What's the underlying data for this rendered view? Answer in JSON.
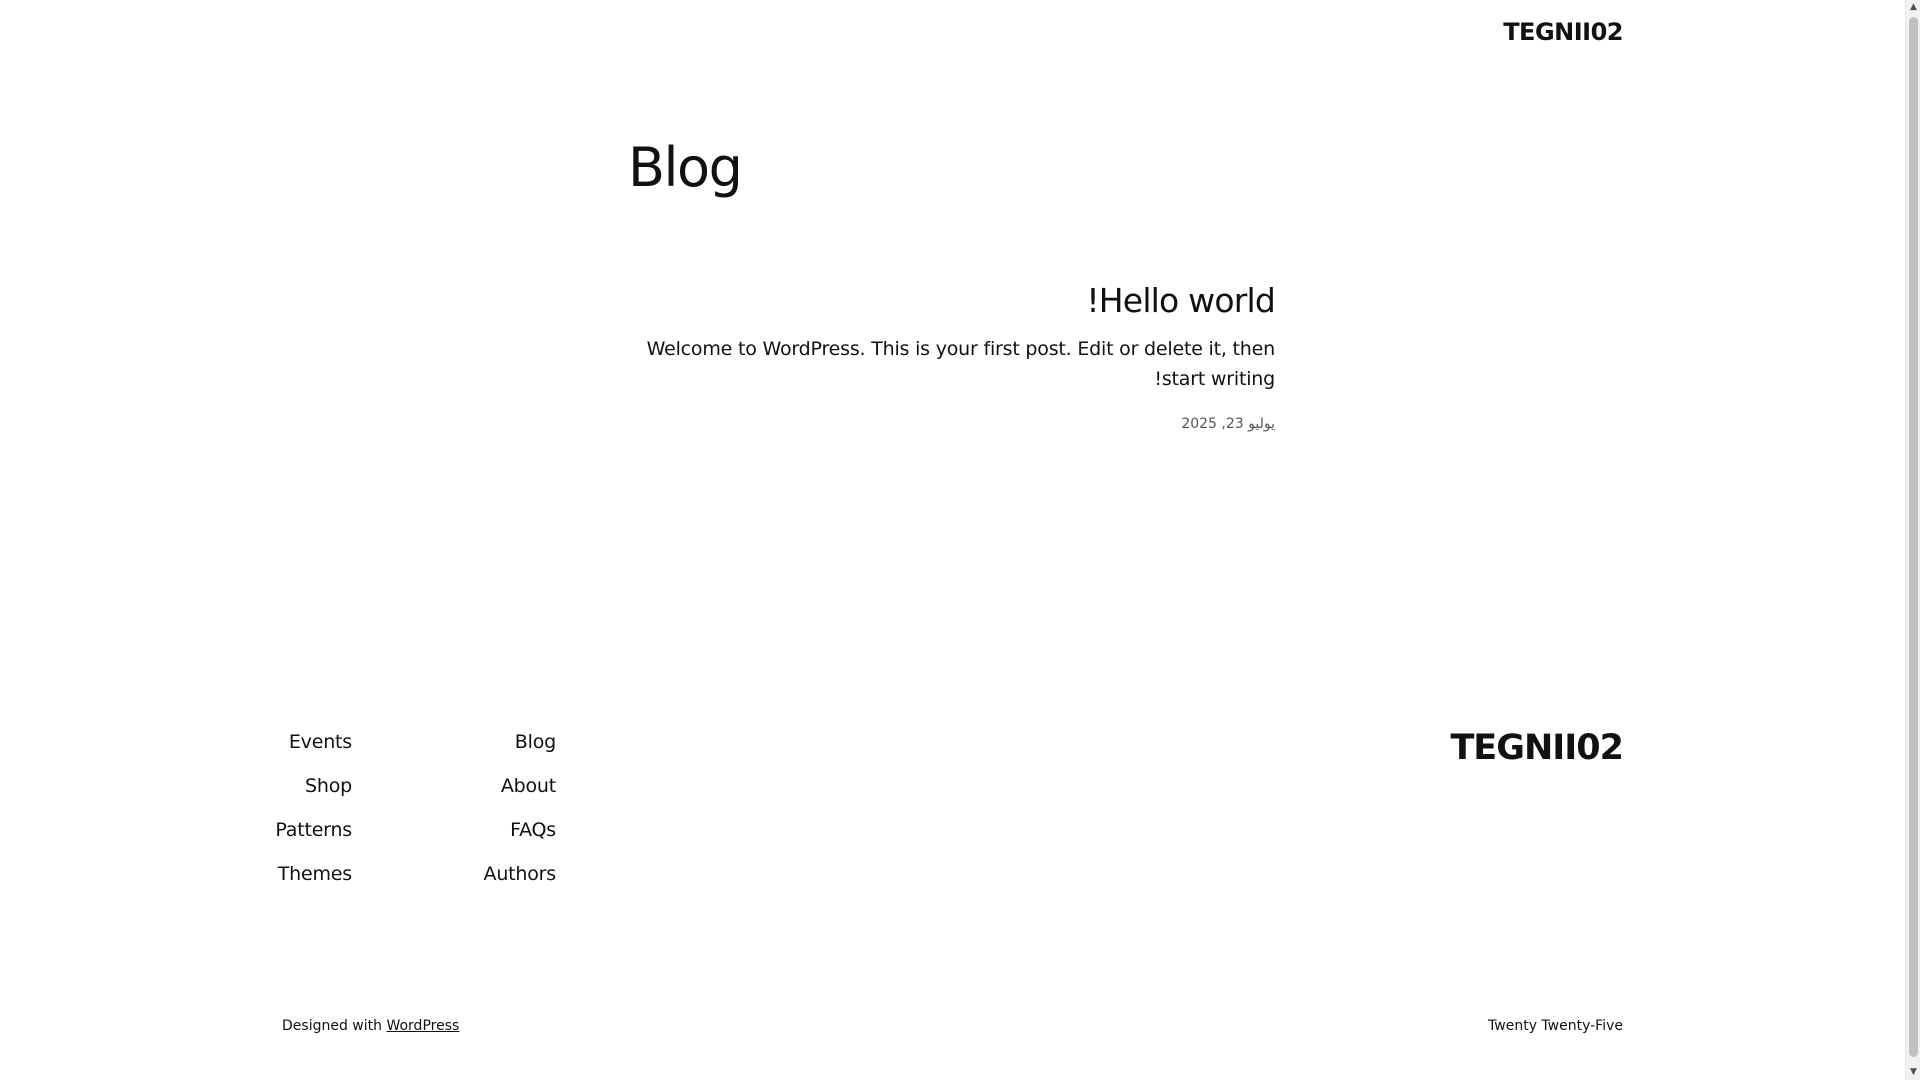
{
  "header": {
    "site_title": "TEGNII02"
  },
  "main": {
    "page_title": "Blog",
    "post": {
      "title": "Hello world!",
      "excerpt": "Welcome to WordPress. This is your first post. Edit or delete it, then start writing!",
      "date": "يوليو 23, 2025"
    }
  },
  "footer": {
    "site_title": "TEGNII02",
    "nav_col1": [
      "Blog",
      "About",
      "FAQs",
      "Authors"
    ],
    "nav_col2": [
      "Events",
      "Shop",
      "Patterns",
      "Themes"
    ],
    "credit_prefix": "Designed with",
    "credit_link": "WordPress",
    "theme_name": "Twenty Twenty-Five"
  }
}
